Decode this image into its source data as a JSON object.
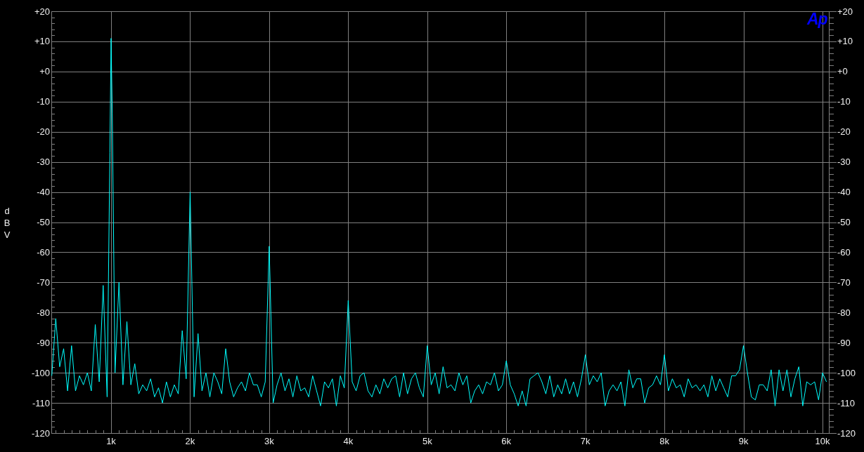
{
  "plot": {
    "logo": "Ap",
    "chart_data": {
      "type": "line",
      "ylabel": "dBV",
      "grid": true,
      "xlim": [
        244,
        10080
      ],
      "ylim": [
        -120,
        20
      ],
      "xticks": [
        {
          "value": 1000,
          "label": "1k"
        },
        {
          "value": 2000,
          "label": "2k"
        },
        {
          "value": 3000,
          "label": "3k"
        },
        {
          "value": 4000,
          "label": "4k"
        },
        {
          "value": 5000,
          "label": "5k"
        },
        {
          "value": 6000,
          "label": "6k"
        },
        {
          "value": 7000,
          "label": "7k"
        },
        {
          "value": 8000,
          "label": "8k"
        },
        {
          "value": 9000,
          "label": "9k"
        },
        {
          "value": 10000,
          "label": "10k"
        }
      ],
      "yticks": [
        {
          "value": 20,
          "label": "+20"
        },
        {
          "value": 10,
          "label": "+10"
        },
        {
          "value": 0,
          "label": "+0"
        },
        {
          "value": -10,
          "label": "-10"
        },
        {
          "value": -20,
          "label": "-20"
        },
        {
          "value": -30,
          "label": "-30"
        },
        {
          "value": -40,
          "label": "-40"
        },
        {
          "value": -50,
          "label": "-50"
        },
        {
          "value": -60,
          "label": "-60"
        },
        {
          "value": -70,
          "label": "-70"
        },
        {
          "value": -80,
          "label": "-80"
        },
        {
          "value": -90,
          "label": "-90"
        },
        {
          "value": -100,
          "label": "-100"
        },
        {
          "value": -110,
          "label": "-110"
        },
        {
          "value": -120,
          "label": "-120"
        }
      ],
      "x": [
        250,
        300,
        350,
        400,
        450,
        500,
        550,
        600,
        650,
        700,
        750,
        800,
        850,
        900,
        950,
        985,
        1000,
        1015,
        1050,
        1100,
        1150,
        1200,
        1250,
        1300,
        1350,
        1400,
        1450,
        1500,
        1550,
        1600,
        1650,
        1700,
        1750,
        1800,
        1850,
        1900,
        1950,
        2000,
        2050,
        2100,
        2150,
        2200,
        2250,
        2300,
        2350,
        2400,
        2450,
        2500,
        2550,
        2600,
        2650,
        2700,
        2750,
        2800,
        2850,
        2900,
        2950,
        3000,
        3050,
        3100,
        3150,
        3200,
        3250,
        3300,
        3350,
        3400,
        3450,
        3500,
        3550,
        3600,
        3650,
        3700,
        3750,
        3800,
        3850,
        3900,
        3950,
        4000,
        4050,
        4100,
        4150,
        4200,
        4250,
        4300,
        4350,
        4400,
        4450,
        4500,
        4550,
        4600,
        4650,
        4700,
        4750,
        4800,
        4850,
        4900,
        4950,
        5000,
        5050,
        5100,
        5150,
        5200,
        5250,
        5300,
        5350,
        5400,
        5450,
        5500,
        5550,
        5600,
        5650,
        5700,
        5750,
        5800,
        5850,
        5900,
        5950,
        6000,
        6050,
        6100,
        6150,
        6200,
        6250,
        6300,
        6350,
        6400,
        6450,
        6500,
        6550,
        6600,
        6650,
        6700,
        6750,
        6800,
        6850,
        6900,
        6950,
        7000,
        7050,
        7100,
        7150,
        7200,
        7250,
        7300,
        7350,
        7400,
        7450,
        7500,
        7550,
        7600,
        7650,
        7700,
        7750,
        7800,
        7850,
        7900,
        7950,
        8000,
        8050,
        8100,
        8150,
        8200,
        8250,
        8300,
        8350,
        8400,
        8450,
        8500,
        8550,
        8600,
        8650,
        8700,
        8750,
        8800,
        8850,
        8900,
        8950,
        9000,
        9050,
        9100,
        9150,
        9200,
        9250,
        9300,
        9350,
        9400,
        9450,
        9500,
        9550,
        9600,
        9650,
        9700,
        9750,
        9800,
        9850,
        9900,
        9950,
        10000,
        10050
      ],
      "series": [
        {
          "color": "#00ffff",
          "values": [
            -101,
            -82,
            -98,
            -92,
            -106,
            -91,
            -106,
            -101,
            -104,
            -100,
            -106,
            -84,
            -103,
            -71,
            -108,
            -27,
            11,
            -14,
            -100,
            -70,
            -104,
            -83,
            -104,
            -97,
            -107,
            -104,
            -106,
            -102,
            -108,
            -105,
            -110,
            -103,
            -108,
            -104,
            -107,
            -86,
            -102,
            -40,
            -108,
            -87,
            -106,
            -100,
            -108,
            -100,
            -103,
            -107,
            -92,
            -103,
            -108,
            -105,
            -103,
            -106,
            -100,
            -104,
            -104,
            -108,
            -103,
            -58,
            -110,
            -104,
            -100,
            -106,
            -102,
            -108,
            -101,
            -106,
            -105,
            -108,
            -101,
            -106,
            -111,
            -103,
            -105,
            -102,
            -111,
            -101,
            -105,
            -76,
            -103,
            -106,
            -101,
            -100,
            -106,
            -108,
            -104,
            -107,
            -102,
            -105,
            -102,
            -101,
            -108,
            -100,
            -107,
            -102,
            -100,
            -105,
            -108,
            -91,
            -104,
            -100,
            -107,
            -98,
            -105,
            -104,
            -106,
            -100,
            -104,
            -101,
            -110,
            -106,
            -104,
            -107,
            -103,
            -104,
            -100,
            -106,
            -104,
            -96,
            -104,
            -107,
            -111,
            -106,
            -111,
            -102,
            -101,
            -100,
            -103,
            -107,
            -101,
            -108,
            -104,
            -107,
            -102,
            -107,
            -103,
            -108,
            -102,
            -94,
            -104,
            -101,
            -103,
            -100,
            -111,
            -106,
            -104,
            -106,
            -103,
            -111,
            -99,
            -105,
            -102,
            -102,
            -110,
            -105,
            -104,
            -101,
            -104,
            -94,
            -106,
            -102,
            -105,
            -104,
            -108,
            -102,
            -105,
            -104,
            -106,
            -104,
            -108,
            -101,
            -106,
            -102,
            -105,
            -108,
            -101,
            -101,
            -99,
            -91,
            -100,
            -108,
            -109,
            -104,
            -104,
            -106,
            -99,
            -111,
            -99,
            -106,
            -99,
            -108,
            -102,
            -98,
            -111,
            -103,
            -104,
            -103,
            -109,
            -100,
            -103
          ]
        }
      ]
    },
    "right_axis": {
      "labels": [
        "+20",
        "+10",
        "+0",
        "-10",
        "-20",
        "-30",
        "-40",
        "-50",
        "-60",
        "-70",
        "-80",
        "-90",
        "-100",
        "-110",
        "-120"
      ]
    }
  }
}
